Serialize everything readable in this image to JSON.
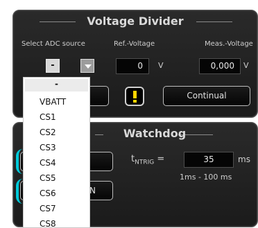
{
  "voltage_divider": {
    "title": "Voltage Divider",
    "adc_label": "Select ADC source",
    "adc_selected": "-",
    "ref_label": "Ref.-Voltage",
    "ref_value": "0",
    "ref_unit": "V",
    "meas_label": "Meas.-Voltage",
    "meas_value": "0,000",
    "meas_unit": "V",
    "continual_label": "Continual"
  },
  "watchdog": {
    "title": "Watchdog",
    "t_label": "t",
    "t_sub": "NTRIG",
    "t_eq": "=",
    "t_value": "35",
    "t_unit": "ms",
    "range": "1ms - 100 ms",
    "partial_button_text": "N"
  },
  "dropdown": {
    "items": [
      "-",
      "VBATT",
      "CS1",
      "CS2",
      "CS3",
      "CS4",
      "CS5",
      "CS6",
      "CS7",
      "CS8"
    ]
  },
  "colors": {
    "accent": "#00c9d9",
    "warning": "#ffd400",
    "panel": "#1f1f1f"
  }
}
